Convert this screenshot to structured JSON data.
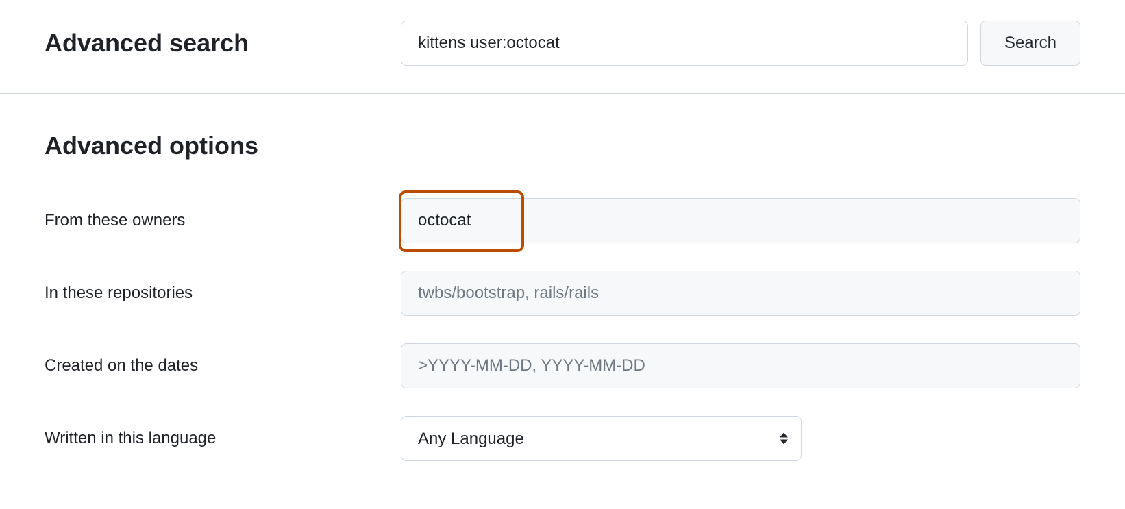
{
  "header": {
    "title": "Advanced search",
    "search_value": "kittens user:octocat",
    "search_button": "Search"
  },
  "options": {
    "title": "Advanced options",
    "owners": {
      "label": "From these owners",
      "value": "octocat",
      "highlighted": true
    },
    "repositories": {
      "label": "In these repositories",
      "placeholder": "twbs/bootstrap, rails/rails",
      "value": ""
    },
    "dates": {
      "label": "Created on the dates",
      "placeholder": ">YYYY-MM-DD, YYYY-MM-DD",
      "value": ""
    },
    "language": {
      "label": "Written in this language",
      "selected": "Any Language"
    }
  }
}
